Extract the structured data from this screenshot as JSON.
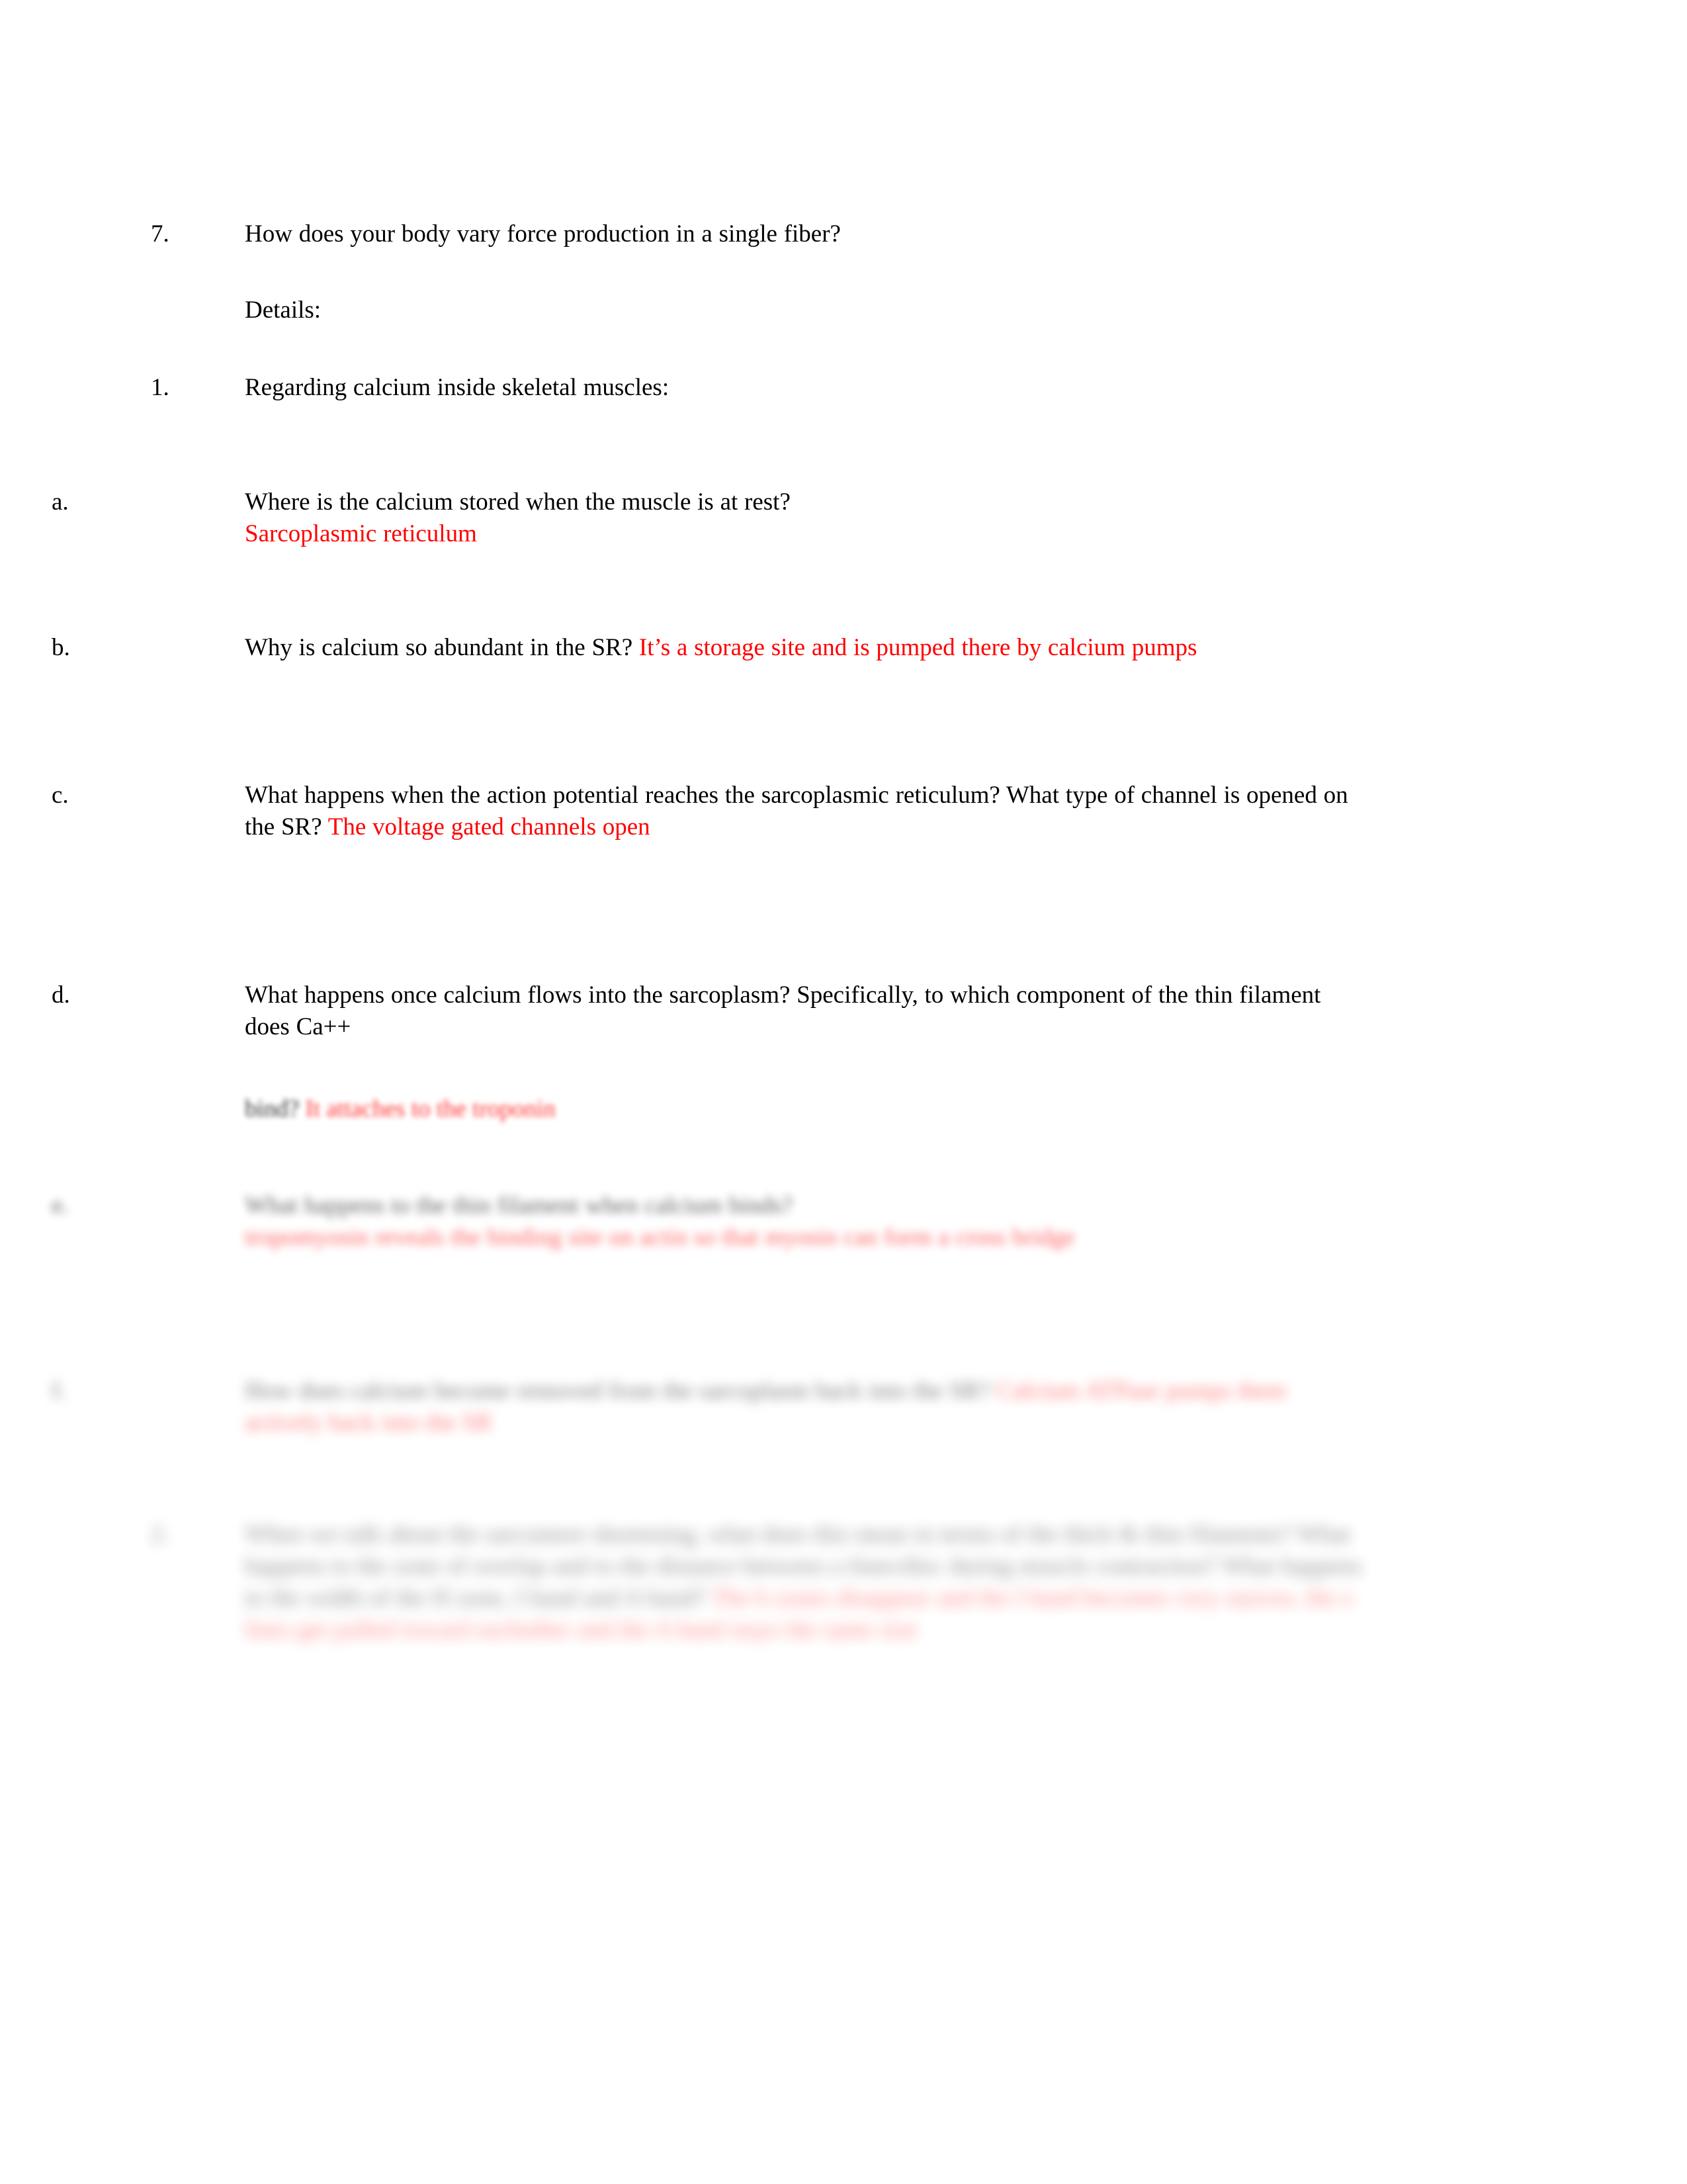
{
  "document": {
    "page_background": "#ffffff",
    "text_color": "#000000",
    "answer_color": "#FF0000",
    "font_size_px": 37
  },
  "blocks": [
    {
      "id": "q7",
      "marker": "7.",
      "level": "number",
      "question": "How does your body vary force production in a single fiber?",
      "answer": "",
      "blur": 0
    },
    {
      "id": "details",
      "marker": "",
      "level": "number",
      "question": "Details:",
      "answer": "",
      "blur": 0
    },
    {
      "id": "q1",
      "marker": "1.",
      "level": "number",
      "question": "Regarding calcium inside skeletal muscles:",
      "answer": "",
      "blur": 0
    },
    {
      "id": "a",
      "marker": "a.",
      "level": "alpha",
      "question": "Where is the calcium stored when the muscle is at rest?",
      "answer": "Sarcoplasmic reticulum",
      "answer_on_new_line": true,
      "blur": 0
    },
    {
      "id": "b",
      "marker": "b.",
      "level": "alpha",
      "question": "Why is calcium so abundant in the SR?",
      "answer": "It’s a storage site and is pumped there by calcium pumps",
      "answer_on_new_line": false,
      "blur": 0
    },
    {
      "id": "c",
      "marker": "c.",
      "level": "alpha",
      "question": "What happens when the action potential reaches the sarcoplasmic reticulum? What type of channel is opened on the SR?",
      "answer": "The voltage gated channels open",
      "answer_on_new_line": false,
      "blur": 0
    },
    {
      "id": "d",
      "marker": "d.",
      "level": "alpha",
      "question_clear": "What happens once calcium flows into the sarcoplasm? Specifically, to which component of the thin filament does Ca++",
      "question_blurred": "bind?",
      "answer": "It attaches to the troponin",
      "answer_on_new_line": false,
      "blur": 2
    },
    {
      "id": "e",
      "marker": "e.",
      "level": "alpha",
      "question": "What happens to the thin filament when calcium binds?",
      "answer": "tropomyosin reveals the binding site on actin so that myosin can form a cross bridge",
      "answer_on_new_line": true,
      "blur": 3
    },
    {
      "id": "f",
      "marker": "f.",
      "level": "alpha",
      "question": "How does calcium become removed from the sarcoplasm back into the SR?",
      "answer": "Calcium ATPase pumps them actively back into the SR",
      "answer_on_new_line": false,
      "blur": 4
    },
    {
      "id": "q2",
      "marker": "2.",
      "level": "number2",
      "question": "When we talk about the sarcomere shortening, what does this mean in terms of the thick & thin filaments? What happens to the zone of overlap and to the distance between z-lines/disc during muscle contraction? What happens to the width of the H zone, I band and A band?",
      "answer": "The h zones disappear and the I band becomes very narrow, the z lines get pulled toward eachother and the A band stays the same size",
      "answer_on_new_line": false,
      "blur": 5
    }
  ]
}
